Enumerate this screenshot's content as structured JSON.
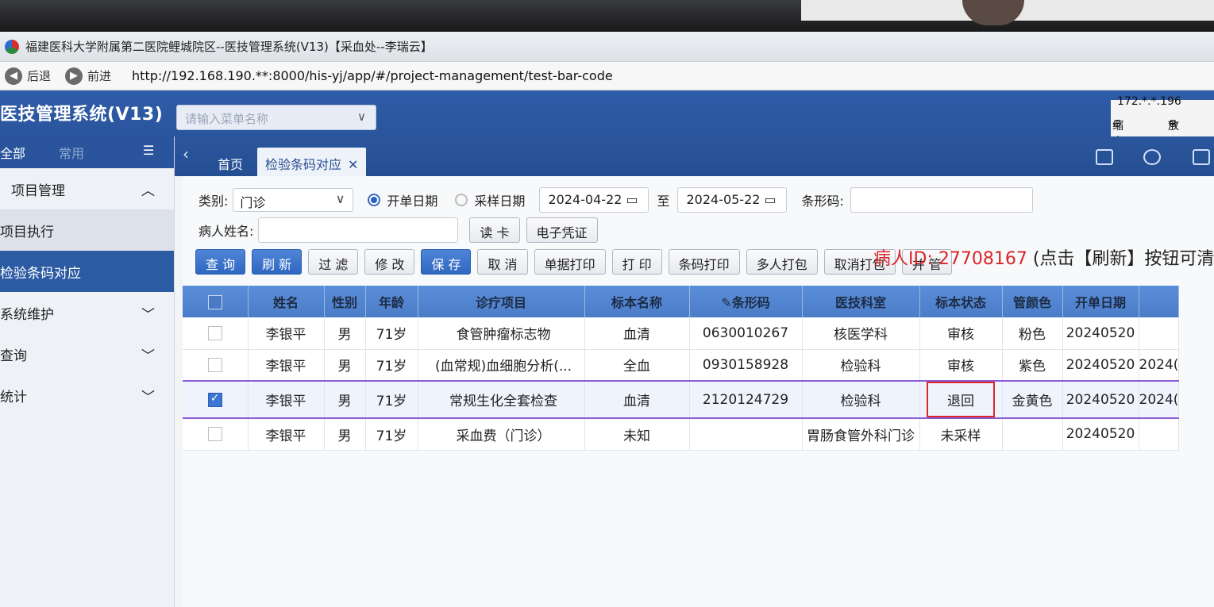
{
  "window": {
    "title": "福建医科大学附属第二医院鲤城院区--医技管理系统(V13)【采血处--李瑞云】",
    "back_label": "后退",
    "forward_label": "前进",
    "url": "http://192.168.190.**:8000/his-yj/app/#/project-management/test-bar-code",
    "ip": "172.*.*.196"
  },
  "header": {
    "system_title": "医技管理系统(V13)",
    "menu_search_placeholder": "请输入菜单名称",
    "zoom_out_label": "缩小",
    "zoom_in_label": "放"
  },
  "tabs": [
    {
      "label": "首页"
    },
    {
      "label": "检验条码对应"
    }
  ],
  "sidebar": {
    "tab_all": "全部",
    "tab_common": "常用",
    "items": [
      {
        "label": "项目管理",
        "chevron": "up"
      },
      {
        "label": "项目执行"
      },
      {
        "label": "检验条码对应"
      },
      {
        "label": "系统维护",
        "chevron": "down"
      },
      {
        "label": "查询",
        "chevron": "down"
      },
      {
        "label": "统计",
        "chevron": "down"
      }
    ]
  },
  "filters": {
    "category_label": "类别:",
    "category_value": "门诊",
    "radio_order_date": "开单日期",
    "radio_sample_date": "采样日期",
    "date_from": "2024-04-22",
    "date_to_label": "至",
    "date_to": "2024-05-22",
    "barcode_label": "条形码:",
    "patient_name_label": "病人姓名:",
    "read_card": "读 卡",
    "e_voucher": "电子凭证"
  },
  "toolbar": {
    "query": "查 询",
    "refresh": "刷 新",
    "filter": "过 滤",
    "modify": "修 改",
    "save": "保 存",
    "cancel": "取 消",
    "print_doc": "单据打印",
    "print": "打 印",
    "print_barcode": "条码打印",
    "multi_pack": "多人打包",
    "cancel_pack": "取消打包",
    "merge_tube": "并 管"
  },
  "notice": {
    "patient_id": "病人ID: 27708167",
    "hint": "(点击【刷新】按钮可清空"
  },
  "table": {
    "columns": [
      "姓名",
      "性别",
      "年龄",
      "诊疗项目",
      "标本名称",
      "条形码",
      "医技科室",
      "标本状态",
      "管颜色",
      "开单日期"
    ],
    "rows": [
      {
        "checked": false,
        "name": "李银平",
        "sex": "男",
        "age": "71岁",
        "item": "食管肿瘤标志物",
        "specimen": "血清",
        "barcode": "0630010267",
        "dept": "核医学科",
        "status": "审核",
        "tube": "粉色",
        "date": "20240520",
        "extra": ""
      },
      {
        "checked": false,
        "name": "李银平",
        "sex": "男",
        "age": "71岁",
        "item": "(血常规)血细胞分析(...",
        "specimen": "全血",
        "barcode": "0930158928",
        "dept": "检验科",
        "status": "审核",
        "tube": "紫色",
        "date": "20240520",
        "extra": "2024("
      },
      {
        "checked": true,
        "name": "李银平",
        "sex": "男",
        "age": "71岁",
        "item": "常规生化全套检查",
        "specimen": "血清",
        "barcode": "2120124729",
        "dept": "检验科",
        "status": "退回",
        "tube": "金黄色",
        "date": "20240520",
        "extra": "2024("
      },
      {
        "checked": false,
        "name": "李银平",
        "sex": "男",
        "age": "71岁",
        "item": "采血费（门诊）",
        "specimen": "未知",
        "barcode": "",
        "dept": "胃肠食管外科门诊",
        "status": "未采样",
        "tube": "",
        "date": "20240520",
        "extra": ""
      }
    ]
  }
}
